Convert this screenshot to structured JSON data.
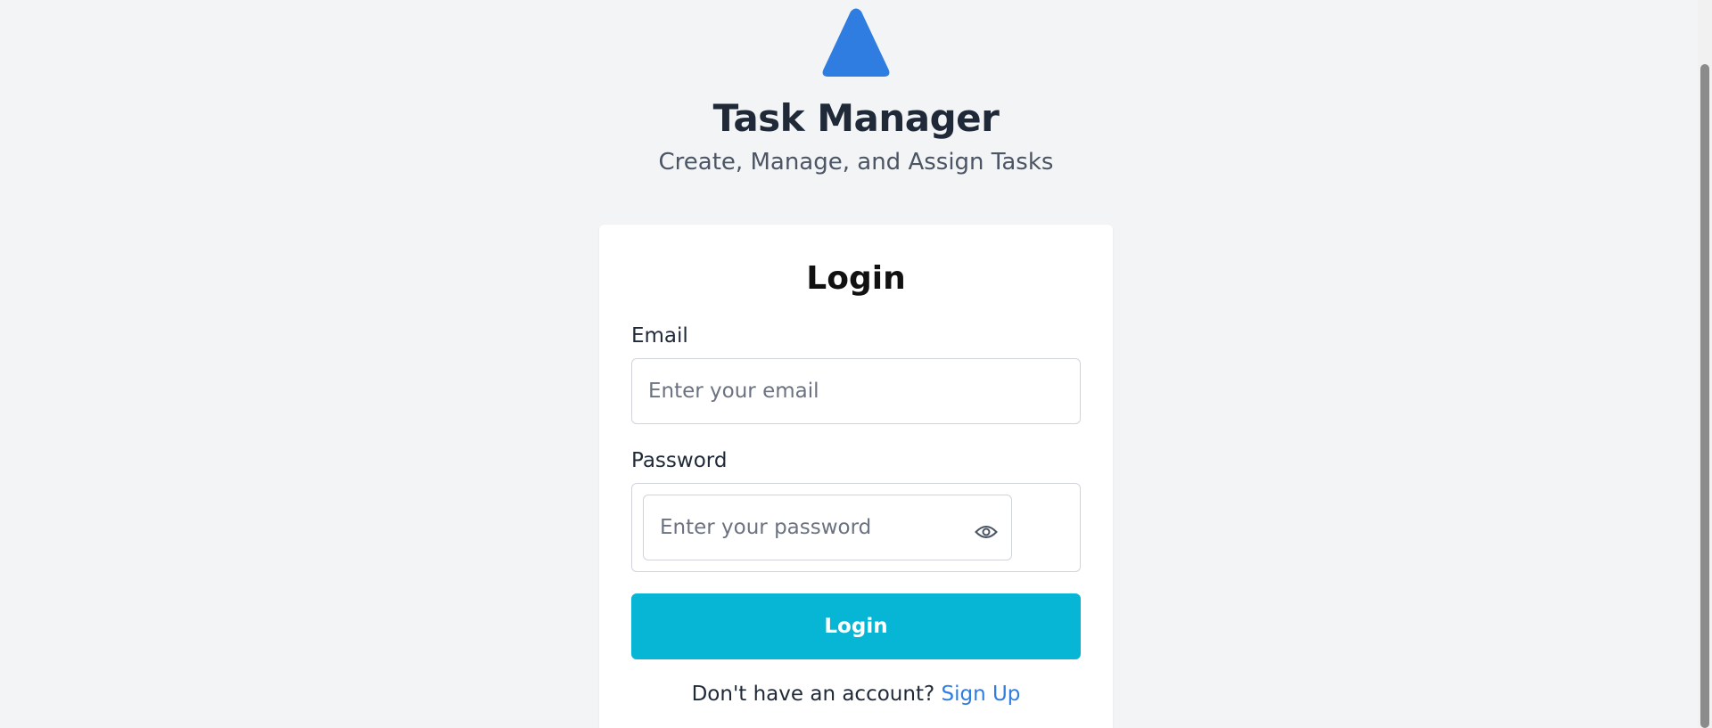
{
  "header": {
    "logo_icon": "triangle-logo-icon",
    "logo_color": "#2f7de1",
    "title": "Task Manager",
    "subtitle": "Create, Manage, and Assign Tasks"
  },
  "login_card": {
    "title": "Login",
    "email": {
      "label": "Email",
      "placeholder": "Enter your email",
      "value": ""
    },
    "password": {
      "label": "Password",
      "placeholder": "Enter your password",
      "value": "",
      "toggle_icon": "eye-icon"
    },
    "submit_label": "Login",
    "submit_color": "#06b6d4",
    "signup_prompt": "Don't have an account?",
    "signup_link": "Sign Up",
    "link_color": "#2f7de1"
  }
}
